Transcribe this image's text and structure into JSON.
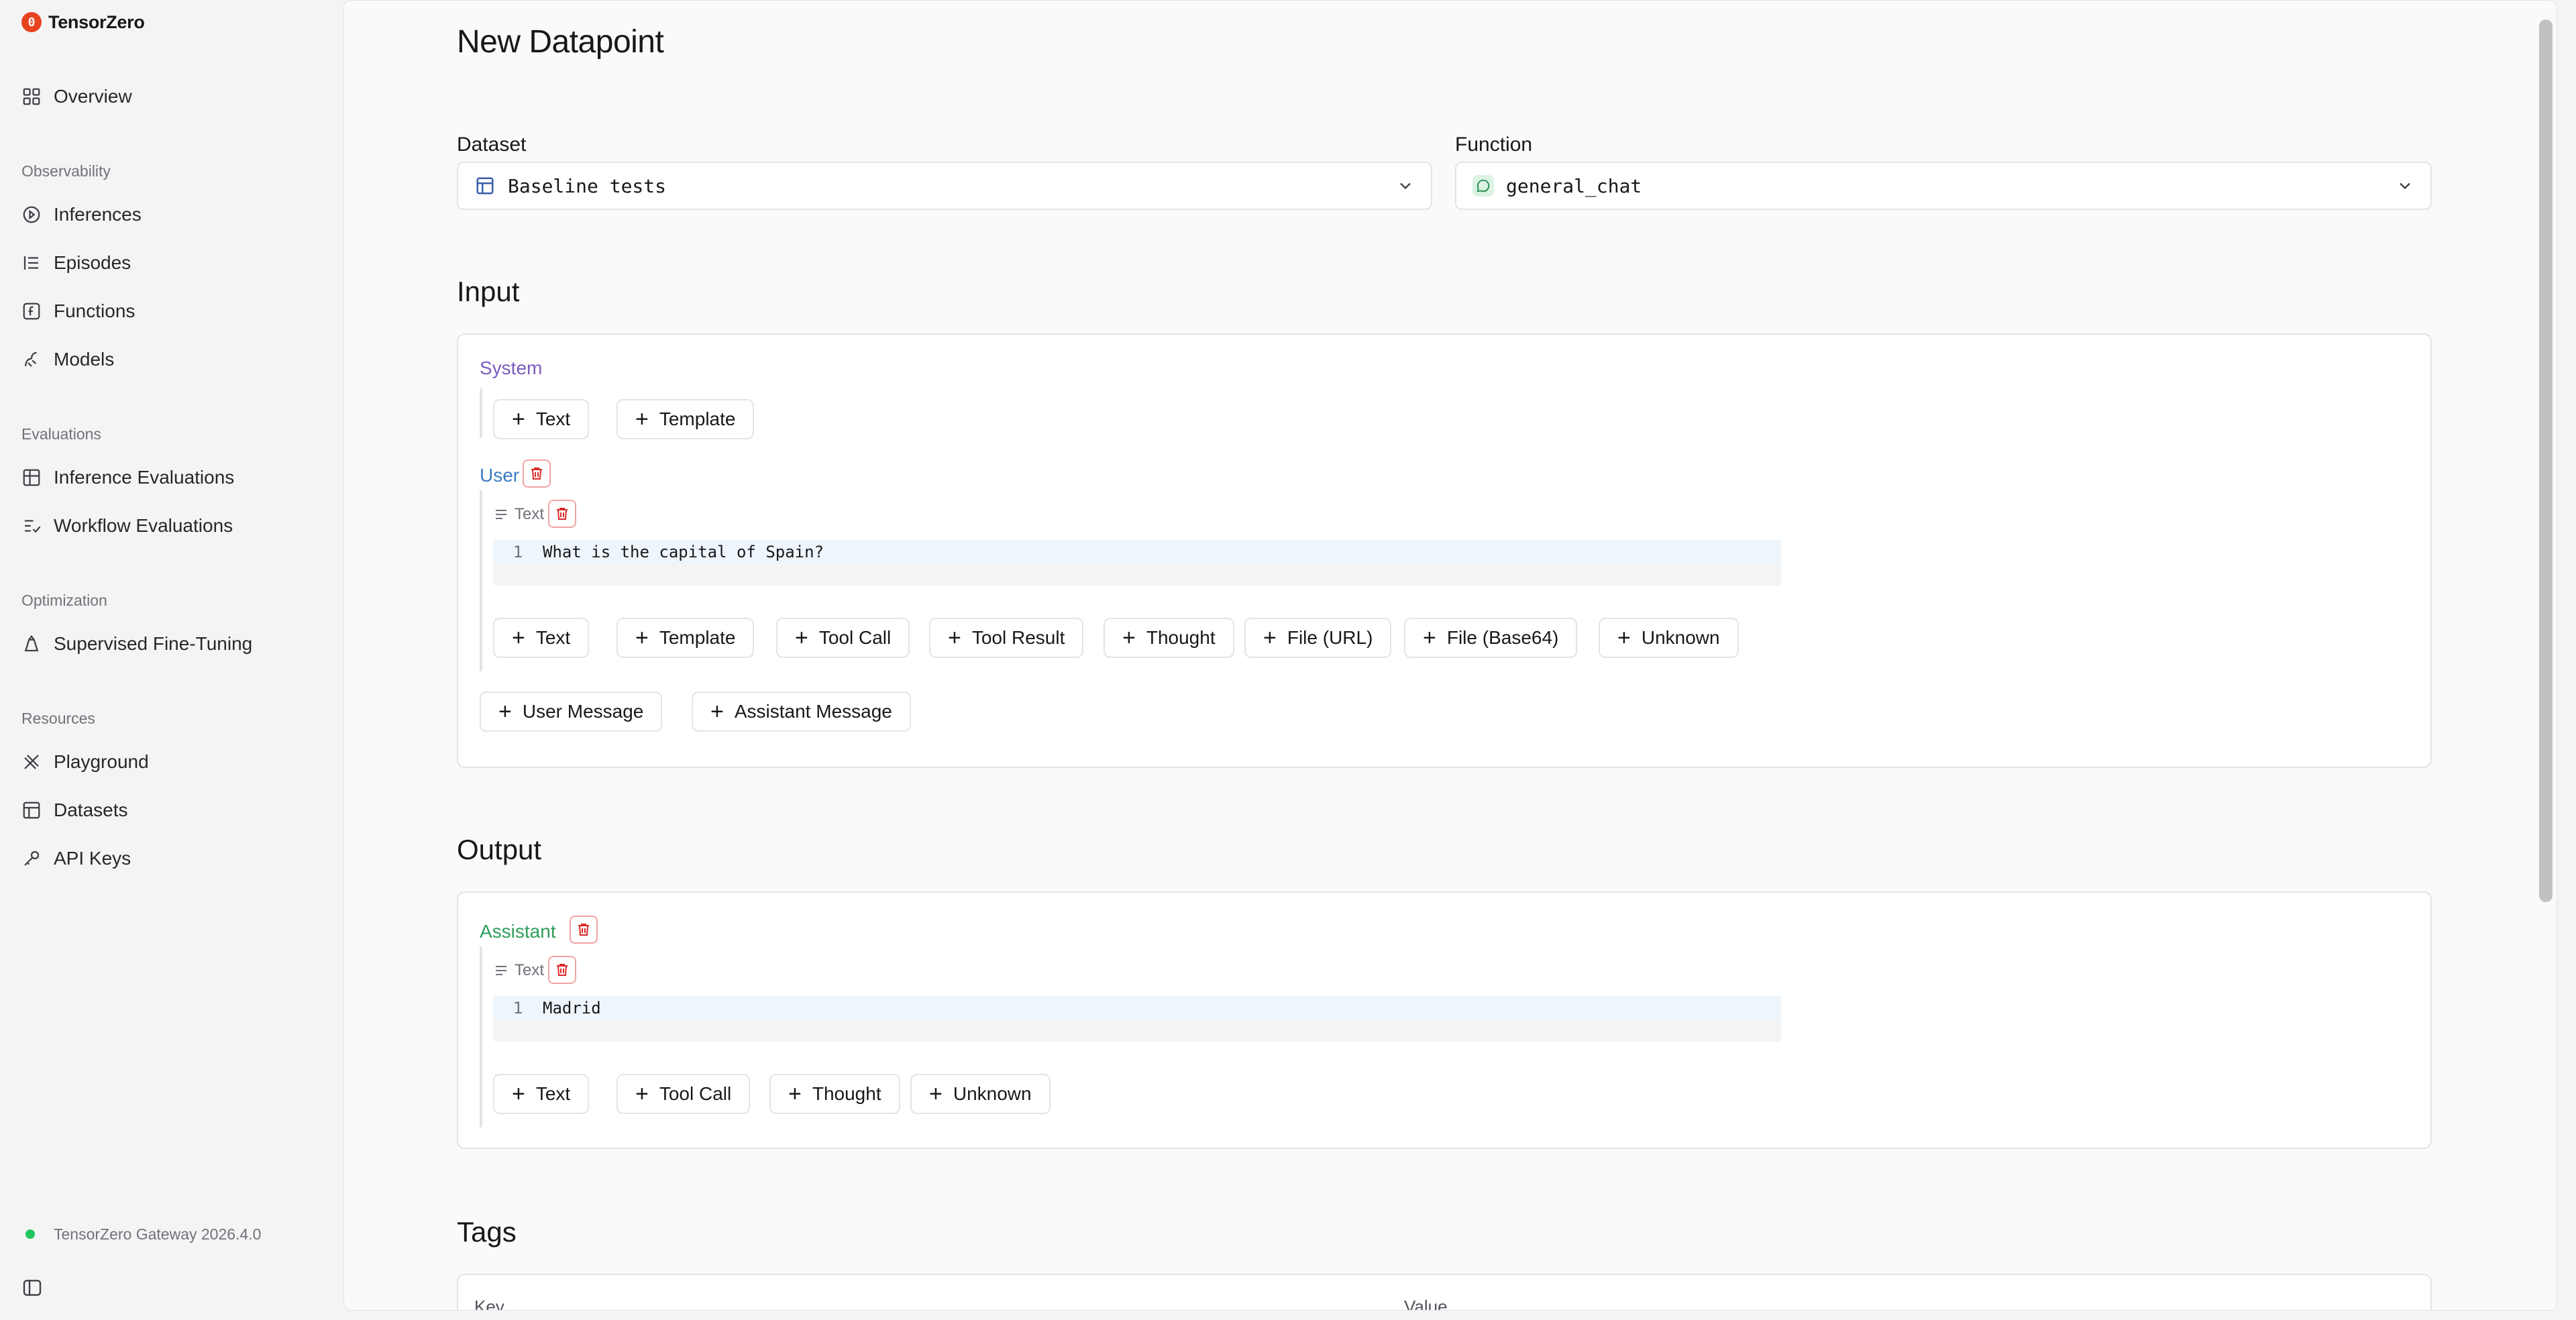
{
  "brand": {
    "name": "TensorZero",
    "logo_glyph": "0"
  },
  "sidebar": {
    "overview": "Overview",
    "groups": {
      "observability": "Observability",
      "evaluations": "Evaluations",
      "optimization": "Optimization",
      "resources": "Resources"
    },
    "items": {
      "inferences": "Inferences",
      "episodes": "Episodes",
      "functions": "Functions",
      "models": "Models",
      "inference_evaluations": "Inference Evaluations",
      "workflow_evaluations": "Workflow Evaluations",
      "supervised_fine_tuning": "Supervised Fine-Tuning",
      "playground": "Playground",
      "datasets": "Datasets",
      "api_keys": "API Keys"
    },
    "status": "TensorZero Gateway 2026.4.0"
  },
  "page": {
    "title": "New Datapoint",
    "dataset_label": "Dataset",
    "dataset_value": "Baseline tests",
    "function_label": "Function",
    "function_value": "general_chat"
  },
  "input": {
    "title": "Input",
    "system_label": "System",
    "system_buttons": [
      "Text",
      "Template"
    ],
    "user_label": "User",
    "text_tag": "Text",
    "line_number": "1",
    "user_text": "What is the capital of Spain?",
    "user_buttons": [
      "Text",
      "Template",
      "Tool Call",
      "Tool Result",
      "Thought",
      "File (URL)",
      "File (Base64)",
      "Unknown"
    ],
    "add_user_message": "User Message",
    "add_assistant_message": "Assistant Message"
  },
  "output": {
    "title": "Output",
    "assistant_label": "Assistant",
    "text_tag": "Text",
    "line_number": "1",
    "assistant_text": "Madrid",
    "buttons": [
      "Text",
      "Tool Call",
      "Thought",
      "Unknown"
    ]
  },
  "tags": {
    "title": "Tags",
    "key_header": "Key",
    "value_header": "Value"
  },
  "colors": {
    "brand": "#e8431f",
    "system_role": "#7c5cbf",
    "user_role": "#3b7dc4",
    "assistant_role": "#2e9e5b",
    "status_online": "#22c55e",
    "danger": "#dc2626"
  }
}
